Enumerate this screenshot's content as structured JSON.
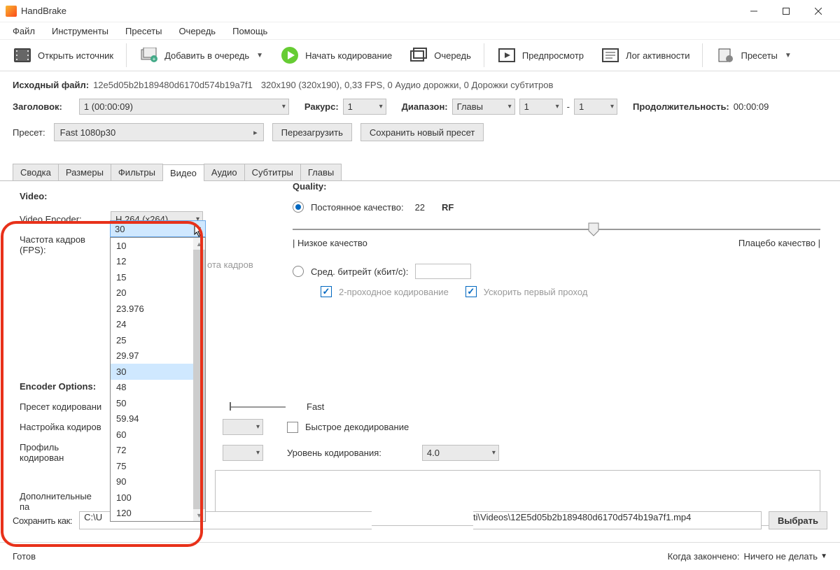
{
  "app": {
    "title": "HandBrake"
  },
  "menu": {
    "file": "Файл",
    "tools": "Инструменты",
    "presets": "Пресеты",
    "queue": "Очередь",
    "help": "Помощь"
  },
  "toolbar": {
    "open": "Открыть источник",
    "add_queue": "Добавить в очередь",
    "start": "Начать кодирование",
    "queue": "Очередь",
    "preview": "Предпросмотр",
    "log": "Лог активности",
    "presets": "Пресеты"
  },
  "source": {
    "label": "Исходный файл:",
    "name": "12e5d05b2b189480d6170d574b19a7f1",
    "info": "320x190 (320x190), 0,33 FPS, 0 Аудио дорожки, 0 Дорожки субтитров"
  },
  "header": {
    "title_label": "Заголовок:",
    "title_value": "1  (00:00:09)",
    "angle_label": "Ракурс:",
    "angle_value": "1",
    "range_label": "Диапазон:",
    "range_type": "Главы",
    "range_from": "1",
    "range_dash": "-",
    "range_to": "1",
    "duration_label": "Продолжительность:",
    "duration_value": "00:00:09"
  },
  "preset": {
    "label": "Пресет:",
    "value": "Fast 1080p30",
    "reload": "Перезагрузить",
    "savenew": "Сохранить новый пресет"
  },
  "tabs": {
    "summary": "Сводка",
    "dims": "Размеры",
    "filters": "Фильтры",
    "video": "Видео",
    "audio": "Аудио",
    "subs": "Субтитры",
    "chapters": "Главы"
  },
  "video": {
    "hdr": "Video:",
    "encoder_label": "Video Encoder:",
    "encoder_value": "H.264 (x264)",
    "fps_label": "Частота кадров (FPS):",
    "fps_selected": "30",
    "fps_options": [
      "10",
      "12",
      "15",
      "20",
      "23.976",
      "24",
      "25",
      "29.97",
      "30",
      "48",
      "50",
      "59.94",
      "60",
      "72",
      "75",
      "90",
      "100",
      "120"
    ],
    "fps_radio_hint_suffix": "ота кадров"
  },
  "quality": {
    "hdr": "Quality:",
    "cq_label": "Постоянное качество:",
    "cq_value": "22",
    "cq_unit": "RF",
    "low": "| Низкое качество",
    "hi": "Плацебо качество |",
    "abr_label": "Сред. битрейт (кбит/с):",
    "twopass": "2-проходное кодирование",
    "turbo": "Ускорить первый проход"
  },
  "enc": {
    "hdr": "Encoder Options:",
    "preset_label": "Пресет кодировани",
    "preset_value": "Fast",
    "tune_label": "Настройка кодиров",
    "fastdecode": "Быстрое декодирование",
    "profile_label": "Профиль кодирован",
    "level_label": "Уровень кодирования:",
    "level_value": "4.0",
    "extra_label": "Дополнительные па"
  },
  "save": {
    "label": "Сохранить как:",
    "prefix": "C:\\U",
    "suffix": "ti",
    "path_right": "\\Videos\\12E5d05b2b189480d6170d574b19a7f1.mp4",
    "browse": "Выбрать"
  },
  "status": {
    "ready": "Готов",
    "done_label": "Когда закончено:",
    "done_value": "Ничего не делать"
  }
}
